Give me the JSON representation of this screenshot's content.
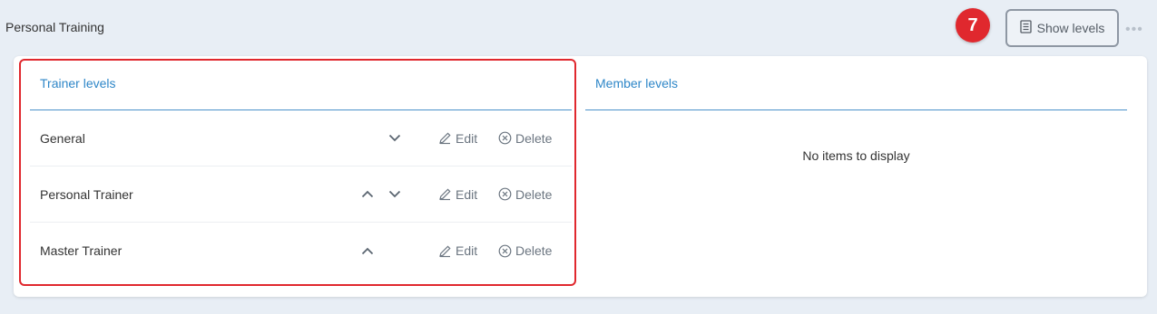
{
  "header": {
    "section_title": "Personal Training",
    "step_number": "7",
    "show_levels_label": "Show levels",
    "more_glyph": "•••"
  },
  "trainer_levels": {
    "title": "Trainer levels",
    "items": [
      {
        "label": "General",
        "has_up": false,
        "has_down": true
      },
      {
        "label": "Personal Trainer",
        "has_up": true,
        "has_down": true
      },
      {
        "label": "Master Trainer",
        "has_up": true,
        "has_down": false
      }
    ],
    "edit_label": "Edit",
    "delete_label": "Delete"
  },
  "member_levels": {
    "title": "Member levels",
    "empty_text": "No items to display"
  },
  "colors": {
    "accent_blue": "#2f87c8",
    "highlight_red": "#e0282e",
    "background": "#e8eef5"
  },
  "icons": {
    "show_levels": "document-icon",
    "edit": "pencil-icon",
    "delete": "circle-x-icon",
    "up": "chevron-up-icon",
    "down": "chevron-down-icon",
    "more": "more-dots-icon"
  }
}
